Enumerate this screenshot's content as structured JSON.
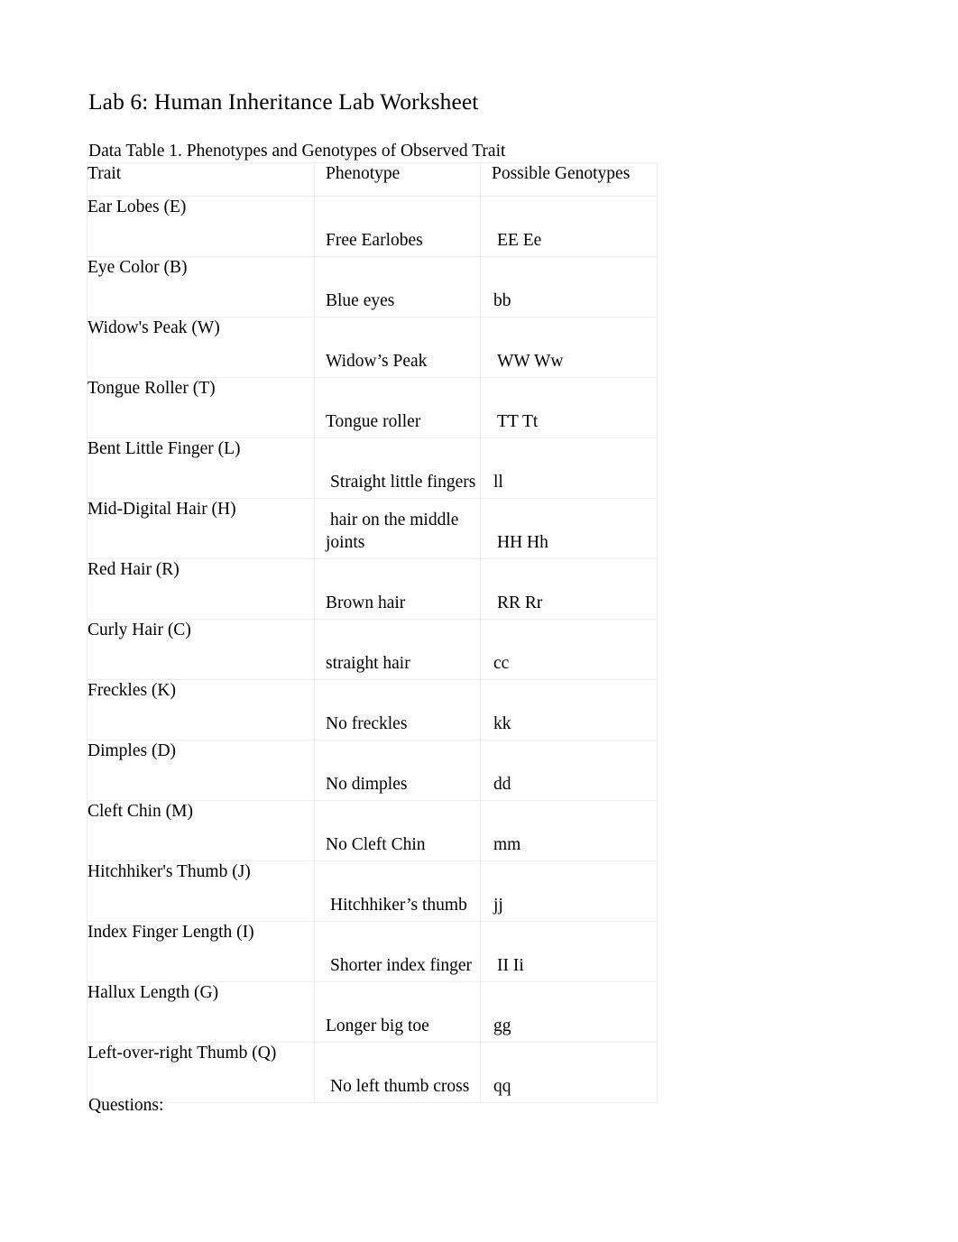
{
  "document": {
    "title": "Lab 6: Human Inheritance Lab Worksheet",
    "caption": "Data Table 1. Phenotypes and Genotypes of Observed Trait",
    "questions_label": "Questions:"
  },
  "table": {
    "headers": {
      "trait": "Trait",
      "phenotype": "Phenotype",
      "genotypes": "Possible Genotypes"
    },
    "rows": [
      {
        "trait": "Ear Lobes (E)",
        "phenotype": "Free Earlobes",
        "genotypes": "EE Ee"
      },
      {
        "trait": "Eye Color (B)",
        "phenotype": "Blue eyes",
        "genotypes": "bb"
      },
      {
        "trait": "Widow's Peak (W)",
        "phenotype": "Widow’s Peak",
        "genotypes": "WW Ww"
      },
      {
        "trait": "Tongue Roller (T)",
        "phenotype": "Tongue roller",
        "genotypes": "TT Tt"
      },
      {
        "trait": "Bent Little Finger (L)",
        "phenotype": "Straight little fingers",
        "genotypes": "ll"
      },
      {
        "trait": "Mid-Digital Hair (H)",
        "phenotype": "hair on the middle joints",
        "genotypes": "HH Hh"
      },
      {
        "trait": "Red Hair (R)",
        "phenotype": "Brown hair",
        "genotypes": "RR Rr"
      },
      {
        "trait": "Curly Hair (C)",
        "phenotype": "straight hair",
        "genotypes": "cc"
      },
      {
        "trait": "Freckles (K)",
        "phenotype": "No freckles",
        "genotypes": "kk"
      },
      {
        "trait": "Dimples (D)",
        "phenotype": "No dimples",
        "genotypes": "dd"
      },
      {
        "trait": "Cleft Chin (M)",
        "phenotype": "No Cleft Chin",
        "genotypes": "mm"
      },
      {
        "trait": "Hitchhiker's Thumb (J)",
        "phenotype": "Hitchhiker’s thumb",
        "genotypes": "jj"
      },
      {
        "trait": "Index Finger Length (I)",
        "phenotype": "Shorter index finger",
        "genotypes": "II Ii"
      },
      {
        "trait": "Hallux Length (G)",
        "phenotype": "Longer big toe",
        "genotypes": "gg"
      },
      {
        "trait": "Left-over-right Thumb (Q)",
        "phenotype": "No left thumb cross",
        "genotypes": "qq"
      }
    ]
  },
  "colors": {
    "page_background": "#ffffff",
    "text": "#000000",
    "table_gridline": "#ededed"
  }
}
